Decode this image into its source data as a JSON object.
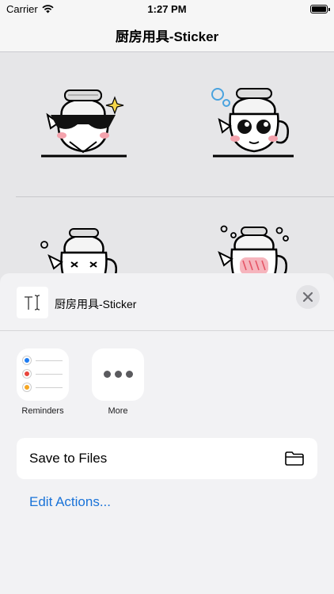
{
  "status_bar": {
    "carrier": "Carrier",
    "time": "1:27 PM"
  },
  "nav": {
    "title": "厨房用具-Sticker"
  },
  "stickers": [
    {
      "name": "sunglasses-kettle-sticker"
    },
    {
      "name": "bubble-kettle-sticker"
    },
    {
      "name": "sleepy-kettle-sticker"
    },
    {
      "name": "blushing-kettle-sticker"
    }
  ],
  "share_sheet": {
    "title": "厨房用具-Sticker",
    "apps": [
      {
        "label": "Reminders",
        "icon": "reminders-icon"
      },
      {
        "label": "More",
        "icon": "more-icon"
      }
    ],
    "save_to_files_label": "Save to Files",
    "edit_actions_label": "Edit Actions..."
  },
  "colors": {
    "accent": "#1a73d8",
    "reminder_blue": "#1e7cf2",
    "reminder_red": "#e8453c",
    "reminder_orange": "#f5a623",
    "sticker_blush": "#f4a3ad"
  }
}
